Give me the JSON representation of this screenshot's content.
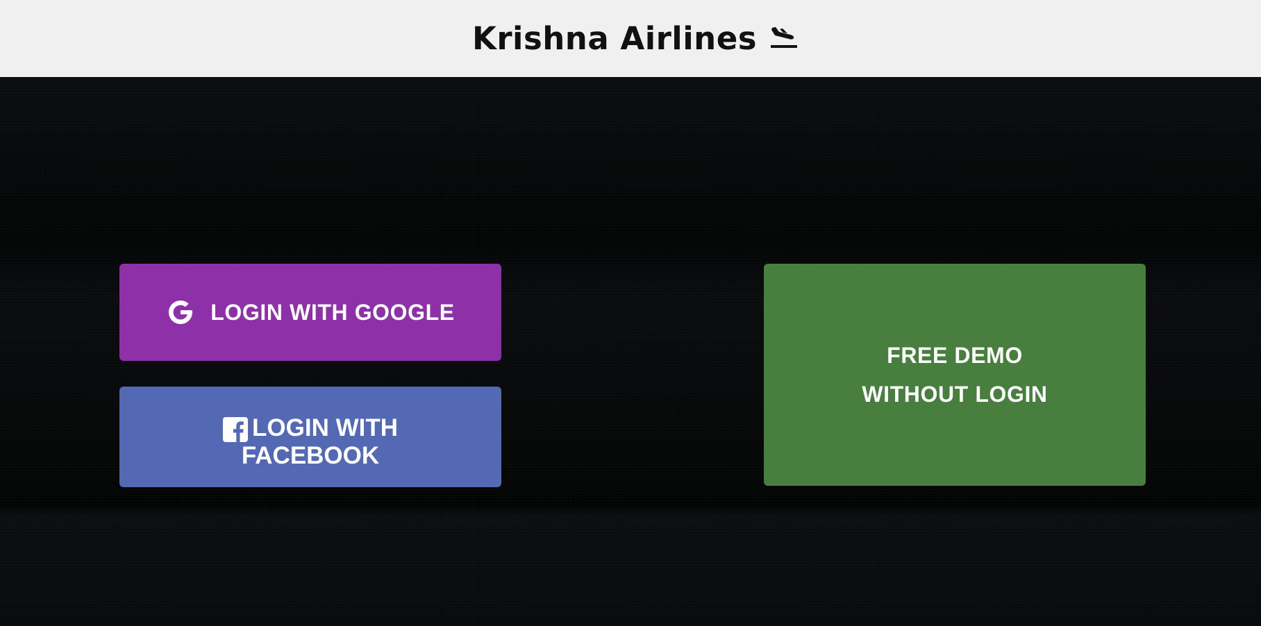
{
  "header": {
    "title": "Krishna Airlines",
    "icon": "flight-land-icon"
  },
  "buttons": {
    "google": {
      "label": "LOGIN WITH GOOGLE",
      "icon": "google-icon",
      "color": "#8e31a8"
    },
    "facebook": {
      "label_line1": "LOGIN WITH",
      "label_line2": "FACEBOOK",
      "icon": "facebook-icon",
      "color": "#5369b4"
    },
    "demo": {
      "label_line1": "FREE DEMO",
      "label_line2": "WITHOUT LOGIN",
      "color": "#487f3e"
    }
  }
}
